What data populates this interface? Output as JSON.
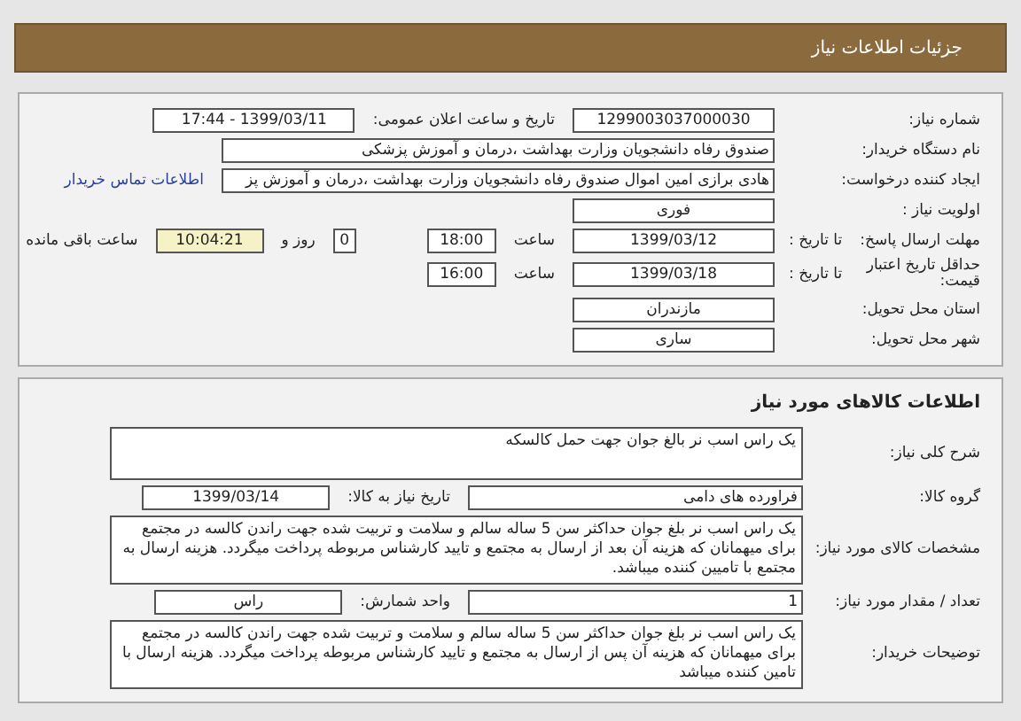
{
  "header": {
    "title": "جزئیات اطلاعات نیاز"
  },
  "request_panel": {
    "rows": [
      {
        "label": "شماره نیاز:",
        "items": [
          {
            "kind": "medium",
            "value": "1299003037000030"
          },
          {
            "kind": "label",
            "text": "تاریخ و ساعت اعلان عمومی:"
          },
          {
            "kind": "medium",
            "value": "1399/03/11 - 17:44"
          }
        ]
      },
      {
        "label": "نام دستگاه خریدار:",
        "items": [
          {
            "kind": "long",
            "value": "صندوق رفاه دانشجویان وزارت بهداشت ،درمان و آموزش پزشکی"
          }
        ]
      },
      {
        "label": "ایجاد کننده درخواست:",
        "items": [
          {
            "kind": "long",
            "value": "هادی برازی امین اموال صندوق رفاه دانشجویان وزارت بهداشت ،درمان و آموزش پز"
          },
          {
            "kind": "link",
            "text": "اطلاعات تماس خریدار"
          }
        ]
      },
      {
        "label": "اولویت نیاز :",
        "items": [
          {
            "kind": "medium",
            "value": "فوری"
          }
        ]
      },
      {
        "label": "مهلت ارسال پاسخ:",
        "sublabel": "تا تاریخ :",
        "items": [
          {
            "kind": "medium",
            "value": "1399/03/12"
          },
          {
            "kind": "label",
            "text": "ساعت"
          },
          {
            "kind": "time",
            "value": "18:00"
          },
          {
            "kind": "tiny",
            "value": "0"
          },
          {
            "kind": "label",
            "text": "روز و"
          },
          {
            "kind": "timer",
            "value": "10:04:21"
          },
          {
            "kind": "label",
            "text": "ساعت باقی مانده"
          }
        ]
      },
      {
        "label": "حداقل تاریخ اعتبار قیمت:",
        "sublabel": "تا تاریخ :",
        "items": [
          {
            "kind": "medium",
            "value": "1399/03/18"
          },
          {
            "kind": "label",
            "text": "ساعت"
          },
          {
            "kind": "time",
            "value": "16:00"
          }
        ]
      },
      {
        "label": "استان محل تحویل:",
        "items": [
          {
            "kind": "medium",
            "value": "مازندران"
          }
        ]
      },
      {
        "label": "شهر محل تحویل:",
        "items": [
          {
            "kind": "medium",
            "value": "ساری"
          }
        ]
      }
    ]
  },
  "goods_panel": {
    "title": "اطلاعات کالاهای مورد نیاز",
    "rows": [
      {
        "label": "شرح کلی نیاز:",
        "items": [
          {
            "kind": "area",
            "value": "یک راس اسب نر بالغ جوان جهت حمل کالسکه"
          }
        ]
      },
      {
        "label": "گروه کالا:",
        "items": [
          {
            "kind": "group",
            "value": "فراورده های دامی"
          },
          {
            "kind": "label",
            "text": "تاریخ نیاز به کالا:"
          },
          {
            "kind": "date",
            "value": "1399/03/14"
          }
        ]
      },
      {
        "label": "مشخصات کالای مورد نیاز:",
        "items": [
          {
            "kind": "area",
            "value": "یک راس اسب نر بلغ جوان حداکثر سن 5 ساله سالم و سلامت و تربیت شده جهت راندن کالسه در مجتمع برای میهمانان که هزینه آن بعد از ارسال به مجتمع و تایید کارشناس مربوطه پرداخت میگردد. هزینه ارسال به مجتمع با تامیین کننده میباشد."
          }
        ]
      },
      {
        "label": "تعداد / مقدار مورد نیاز:",
        "items": [
          {
            "kind": "group",
            "value": "1"
          },
          {
            "kind": "label",
            "text": "واحد شمارش:"
          },
          {
            "kind": "date",
            "value": "راس"
          }
        ]
      },
      {
        "label": "توضیحات خریدار:",
        "items": [
          {
            "kind": "area",
            "value": "یک راس اسب نر بلغ جوان حداکثر سن 5 ساله سالم و سلامت و تربیت شده جهت راندن کالسه در مجتمع برای میهمانان که هزینه آن پس از ارسال به مجتمع و تایید کارشناس مربوطه پرداخت میگردد. هزینه ارسال با تامین کننده میباشد"
          }
        ]
      }
    ]
  }
}
